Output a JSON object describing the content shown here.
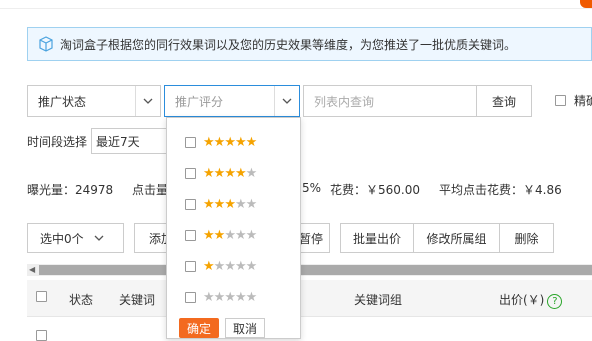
{
  "notice": {
    "text": "淘词盒子根据您的同行效果词以及您的历史效果等维度，为您推送了一批优质关键词。",
    "icon": "cube-icon"
  },
  "filters": {
    "status_value": "推广状态",
    "rating_placeholder": "推广评分",
    "search_placeholder": "列表内查询",
    "query_label": "查询",
    "exact_label": "精确"
  },
  "time": {
    "label": "时间段选择",
    "value": "最近7天"
  },
  "stats": {
    "impressions": "曝光量：24978",
    "clicks_partial": "点击量",
    "ctr_partial": "5%",
    "cost": "花费：￥560.00",
    "avg_click_cost": "平均点击花费：￥4.86"
  },
  "toolbar": {
    "selected": "选中0个",
    "add_partial": "添加",
    "pause_partial": "暂停",
    "batch_bid": "批量出价",
    "change_group": "修改所属组",
    "delete": "删除"
  },
  "table": {
    "headers": {
      "status": "状态",
      "keyword": "关键词",
      "group": "关键词组",
      "bid": "出价(￥)",
      "help": "?"
    }
  },
  "rating_dropdown": {
    "options": [
      {
        "stars": 5
      },
      {
        "stars": 4
      },
      {
        "stars": 3
      },
      {
        "stars": 2
      },
      {
        "stars": 1
      },
      {
        "stars": 0
      }
    ],
    "confirm": "确定",
    "cancel": "取消"
  },
  "colors": {
    "accent_blue": "#2b8ddc",
    "star": "#f5a300",
    "confirm_orange": "#f36a1f"
  }
}
